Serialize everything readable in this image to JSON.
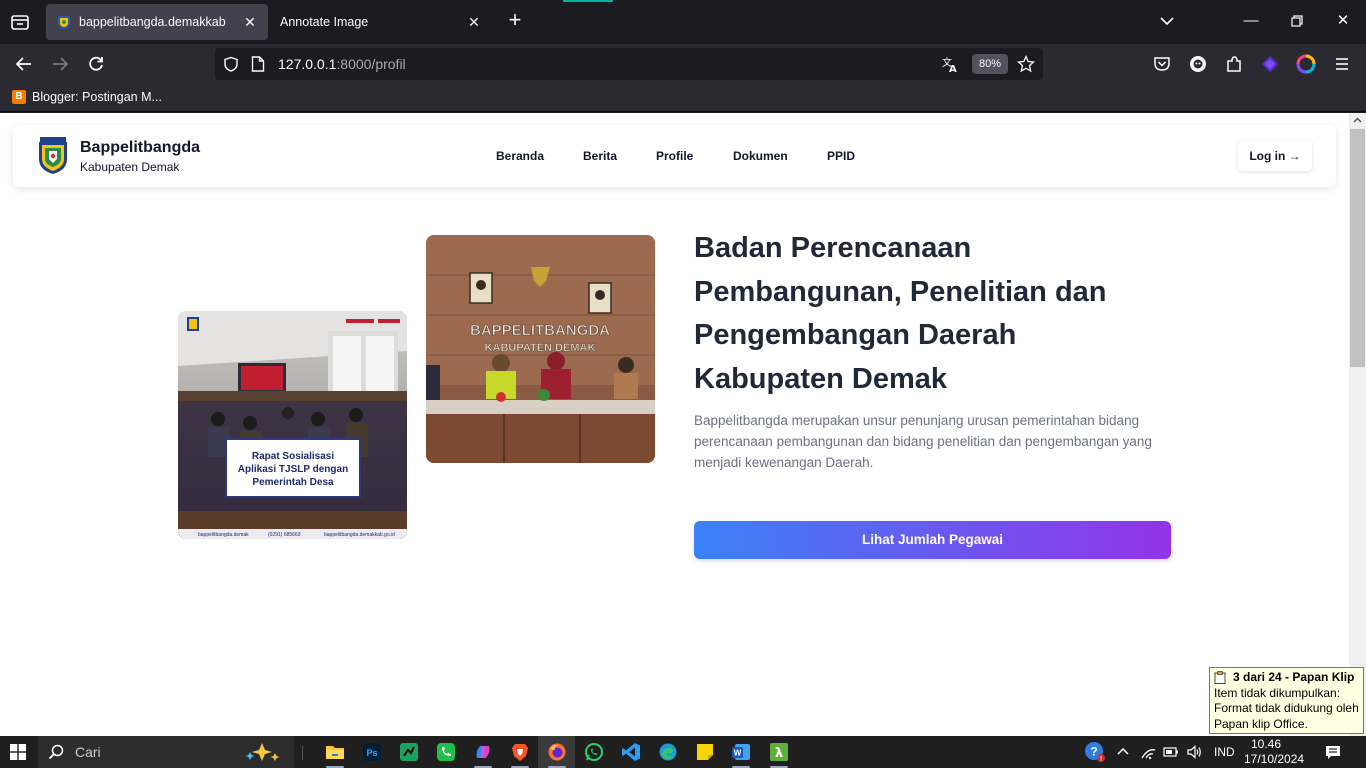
{
  "browser": {
    "tabs": [
      {
        "title": "bappelitbangda.demakkab",
        "active": true
      },
      {
        "title": "Annotate Image",
        "active": false
      }
    ],
    "url_host": "127.0.0.1",
    "url_rest": ":8000/profil",
    "zoom": "80%",
    "bookmarks": [
      {
        "label": "Blogger: Postingan M..."
      }
    ]
  },
  "site": {
    "brand_name": "Bappelitbangda",
    "brand_sub": "Kabupaten Demak",
    "menu": [
      "Beranda",
      "Berita",
      "Profile",
      "Dokumen",
      "PPID"
    ],
    "login_label": "Log in →"
  },
  "hero": {
    "title": "Badan Perencanaan Pembangunan, Penelitian dan Pengembangan Daerah Kabupaten Demak",
    "description": "Bappelitbangda merupakan unsur penunjang urusan pemerintahan bidang perencanaan pembangunan dan bidang penelitian dan pengembangan yang menjadi kewenangan Daerah.",
    "button_label": "Lihat Jumlah Pegawai",
    "gradient_colors": [
      "#3b82f6",
      "#9333ea"
    ],
    "photo1": {
      "caption": [
        "Rapat Sosialisasi",
        "Aplikasi TJSLP dengan",
        "Pemerintah Desa"
      ],
      "footer": [
        "bappelitbangda.demak",
        "(0291) 685663",
        "bappelitbangda.demakkab.go.id"
      ]
    },
    "photo2": {
      "sign": [
        "BAPPELITBANGDA",
        "KABUPATEN DEMAK"
      ]
    }
  },
  "clipboard": {
    "title": "3 dari 24 - Papan Klip",
    "lines": [
      "Item tidak dikumpulkan:",
      "Format tidak didukung oleh",
      "Papan klip Office."
    ]
  },
  "taskbar": {
    "search_placeholder": "Cari",
    "language": "IND",
    "time": "10.46",
    "date": "17/10/2024"
  }
}
